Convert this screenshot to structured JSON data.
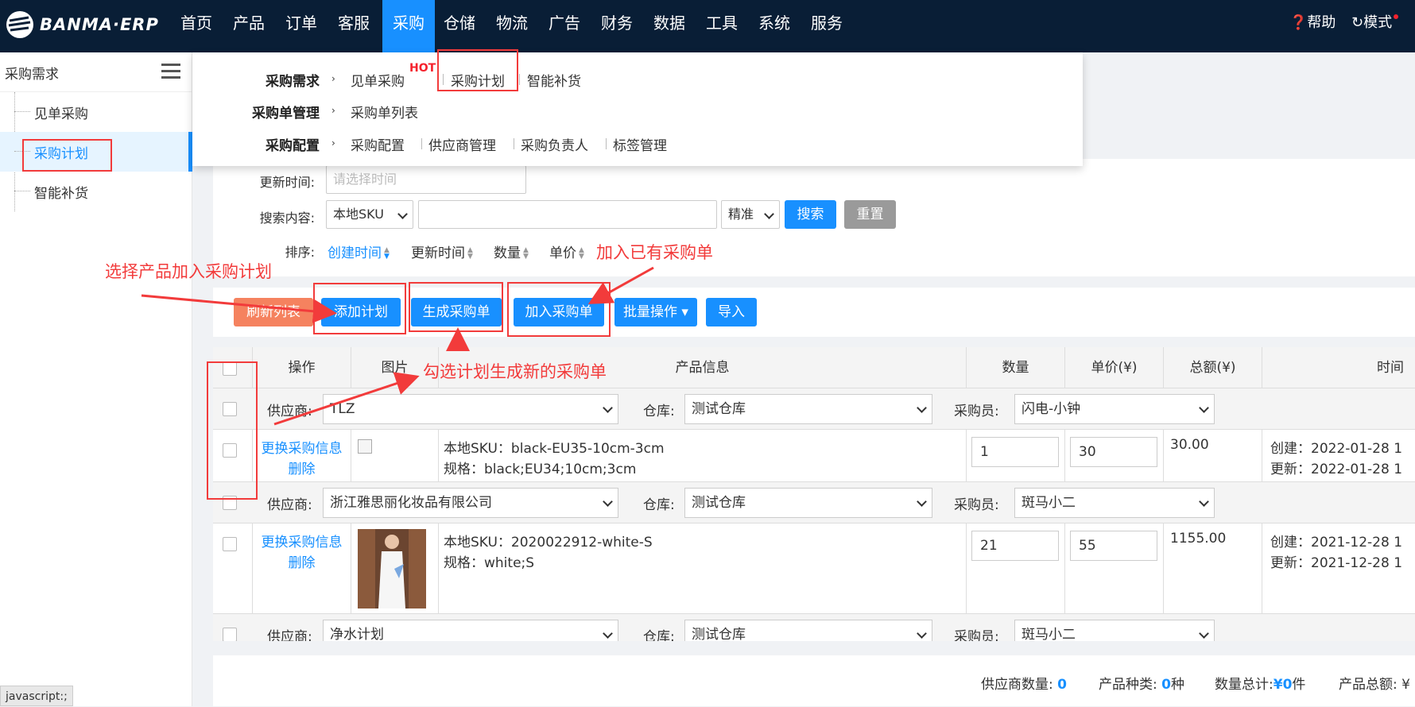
{
  "app": {
    "logo_text": "BANMA·ERP"
  },
  "topnav": {
    "items": [
      "首页",
      "产品",
      "订单",
      "客服",
      "采购",
      "仓储",
      "物流",
      "广告",
      "财务",
      "数据",
      "工具",
      "系统",
      "服务"
    ],
    "active": "采购",
    "help": "帮助",
    "mode": "模式"
  },
  "sidebar": {
    "title": "采购需求",
    "items": [
      "见单采购",
      "采购计划",
      "智能补货"
    ],
    "active": "采购计划"
  },
  "dropdown": {
    "rows": [
      {
        "label": "采购需求",
        "links": [
          "见单采购",
          "采购计划",
          "智能补货"
        ]
      },
      {
        "label": "采购单管理",
        "links": [
          "采购单列表"
        ]
      },
      {
        "label": "采购配置",
        "links": [
          "采购配置",
          "供应商管理",
          "采购负责人",
          "标签管理"
        ]
      }
    ],
    "hot_badge": "HOT"
  },
  "filters": {
    "update_time_label": "更新时间:",
    "update_time_placeholder": "请选择时间",
    "search_label": "搜索内容:",
    "search_field": "本地SKU",
    "search_value": "",
    "match_mode": "精准",
    "search_button": "搜索",
    "reset_button": "重置",
    "sort_label": "排序:",
    "sort_options": [
      "创建时间",
      "更新时间",
      "数量",
      "单价"
    ],
    "sort_active": "创建时间"
  },
  "toolbar": {
    "refresh": "刷新列表",
    "add_plan": "添加计划",
    "gen_po": "生成采购单",
    "add_to_po": "加入采购单",
    "batch": "批量操作",
    "import": "导入"
  },
  "table": {
    "headers": [
      "操作",
      "图片",
      "产品信息",
      "数量",
      "单价(¥)",
      "总额(¥)",
      "时间"
    ],
    "group_labels": {
      "supplier": "供应商:",
      "warehouse": "仓库:",
      "buyer": "采购员:"
    },
    "groups": [
      {
        "supplier": "TLZ",
        "warehouse": "测试仓库",
        "buyer": "闪电-小钟"
      },
      {
        "supplier": "浙江雅思丽化妆品有限公司",
        "warehouse": "测试仓库",
        "buyer": "斑马小二"
      },
      {
        "supplier": "净水计划",
        "warehouse": "测试仓库",
        "buyer": "斑马小二"
      }
    ],
    "rows": [
      {
        "action_change": "更换采购信息",
        "action_delete": "删除",
        "sku": "本地SKU：black-EU35-10cm-3cm",
        "spec": "规格：black;EU34;10cm;3cm",
        "qty": "1",
        "price": "30",
        "total": "30.00",
        "created": "创建：2022-01-28 1",
        "updated": "更新：2022-01-28 1"
      },
      {
        "action_change": "更换采购信息",
        "action_delete": "删除",
        "sku": "本地SKU：2020022912-white-S",
        "spec": "规格：white;S",
        "qty": "21",
        "price": "55",
        "total": "1155.00",
        "created": "创建：2021-12-28 1",
        "updated": "更新：2021-12-28 1"
      }
    ]
  },
  "footer": {
    "supplier_count_label": "供应商数量:",
    "supplier_count": "0",
    "product_types_label": "产品种类:",
    "product_types": "0",
    "product_types_unit": "种",
    "qty_total_label": "数量总计:",
    "qty_total": "¥0",
    "qty_total_unit": "件",
    "product_total_label": "产品总额:",
    "product_total": "¥"
  },
  "annotations": {
    "select_add_plan": "选择产品加入采购计划",
    "add_existing_po": "加入已有采购单",
    "check_gen_po": "勾选计划生成新的采购单"
  },
  "statusbar": "javascript:;",
  "colors": {
    "nav_bg": "#091e36",
    "primary": "#1890ff",
    "refresh": "#f5825f",
    "reset": "#9a9a9a",
    "annotation": "#f23b3b"
  }
}
